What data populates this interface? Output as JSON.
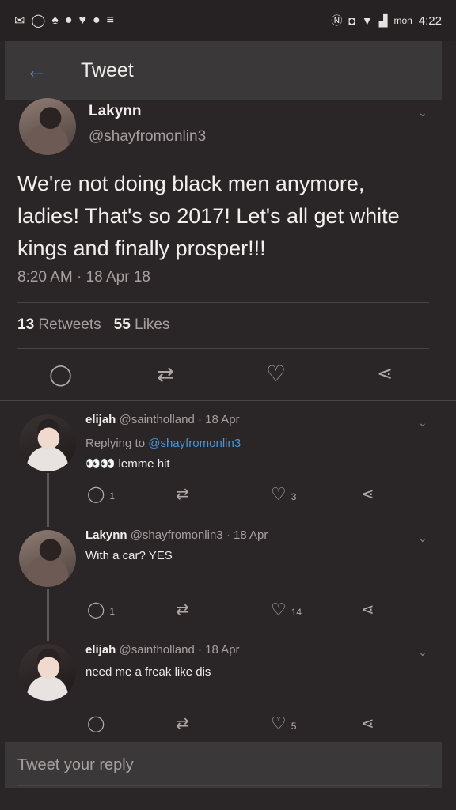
{
  "status_bar": {
    "left_icons": [
      "mail-icon",
      "whatsapp-icon",
      "snapchat-icon",
      "location-icon",
      "twitter-icon",
      "chat-icon",
      "cast-icon"
    ],
    "right_icons": [
      "nfc-icon",
      "vibrate-icon",
      "wifi-icon",
      "signal-icon"
    ],
    "carrier": "mon",
    "time": "4:22"
  },
  "appbar": {
    "title": "Tweet"
  },
  "tweet": {
    "name": "Lakynn",
    "handle": "@shayfromonlin3",
    "text": "We're not doing black men anymore, ladies! That's so 2017! Let's all get white kings and finally prosper!!!",
    "timestamp": "8:20 AM · 18 Apr 18",
    "retweets_count": "13",
    "retweets_label": "Retweets",
    "likes_count": "55",
    "likes_label": "Likes"
  },
  "replies": [
    {
      "name": "elijah",
      "handle": "@saintholland",
      "date": "· 18 Apr",
      "replying_prefix": "Replying to",
      "replying_to": "@shayfromonlin3",
      "text": "👀👀 lemme hit",
      "reply_count": "1",
      "retweet_count": "",
      "like_count": "3"
    },
    {
      "name": "Lakynn",
      "handle": "@shayfromonlin3",
      "date": "· 18 Apr",
      "text": "With a car? YES",
      "reply_count": "1",
      "retweet_count": "",
      "like_count": "14"
    },
    {
      "name": "elijah",
      "handle": "@saintholland",
      "date": "· 18 Apr",
      "text": "need me a freak like dis",
      "reply_count": "",
      "retweet_count": "",
      "like_count": "5"
    }
  ],
  "reply_box": {
    "placeholder": "Tweet your reply"
  },
  "colors": {
    "background": "#2a2526",
    "accent": "#4a95d8",
    "bar": "#3b3839"
  }
}
